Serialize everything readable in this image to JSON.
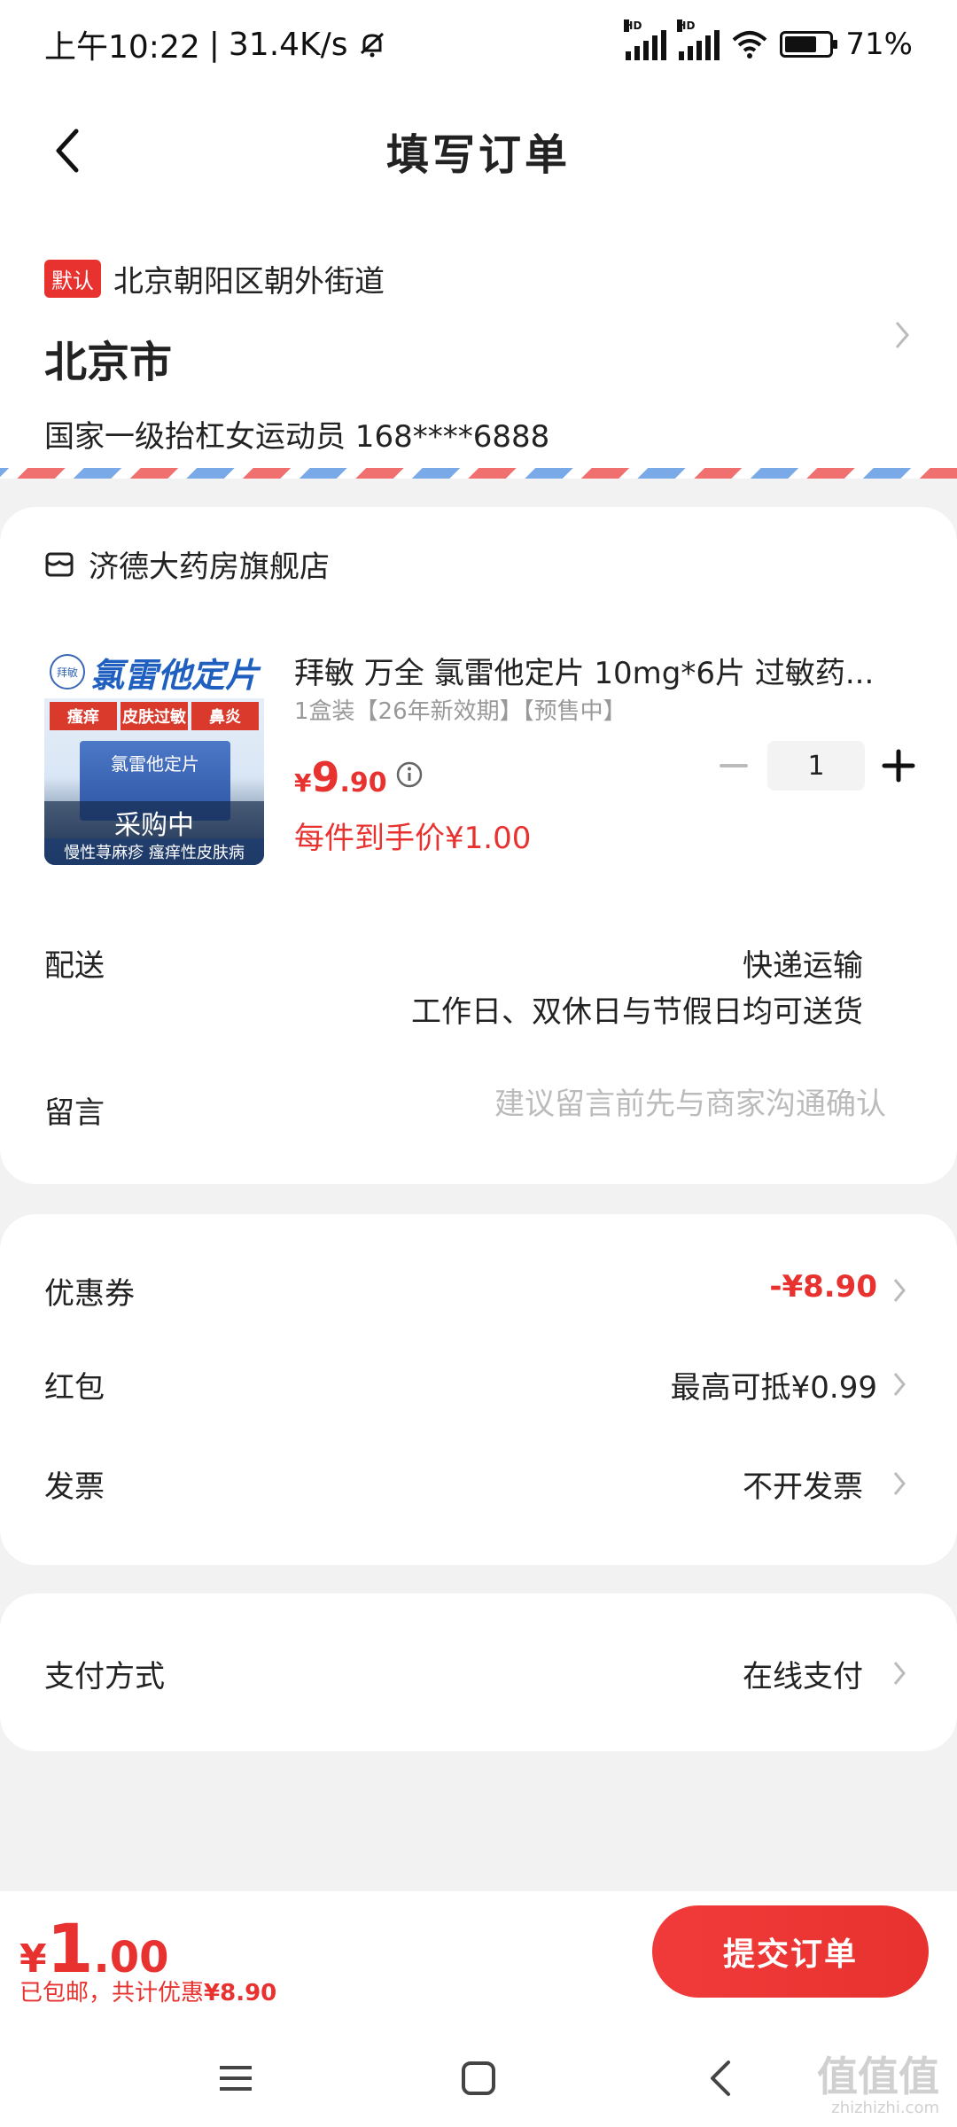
{
  "status_bar": {
    "time": "上午10:22",
    "speed": "31.4K/s",
    "battery": "71%",
    "battery_level": 0.71
  },
  "header": {
    "title": "填写订单"
  },
  "address": {
    "default_badge": "默认",
    "street": "北京朝阳区朝外街道",
    "city": "北京市",
    "contact": "国家一级抬杠女运动员  168****6888"
  },
  "store": {
    "name": "济德大药房旗舰店",
    "product": {
      "image_name": "氯雷他定片",
      "image_tags": [
        "瘙痒",
        "皮肤过敏",
        "鼻炎"
      ],
      "image_box": "氯雷他定片",
      "image_overlay": "采购中",
      "image_bottom": "慢性荨麻疹 瘙痒性皮肤病",
      "title": "拜敏 万全 氯雷他定片 10mg*6片 过敏药...",
      "spec": "1盒装【26年新效期】【预售中】",
      "price_currency": "¥",
      "price_int": "9",
      "price_dec": ".90",
      "final_price": "每件到手价¥1.00",
      "quantity": "1"
    },
    "delivery": {
      "label": "配送",
      "method": "快递运输",
      "note": "工作日、双休日与节假日均可送货"
    },
    "note": {
      "label": "留言",
      "placeholder": "建议留言前先与商家沟通确认"
    }
  },
  "discounts": {
    "coupon": {
      "label": "优惠券",
      "value": "-¥8.90"
    },
    "red_packet": {
      "label": "红包",
      "value": "最高可抵¥0.99"
    },
    "invoice": {
      "label": "发票",
      "value": "不开发票"
    }
  },
  "payment": {
    "label": "支付方式",
    "value": "在线支付"
  },
  "bottom": {
    "total_currency": "¥",
    "total_int": "1",
    "total_dec": ".00",
    "shipping_note": "已包邮，共计优惠",
    "saved": "¥8.90",
    "submit": "提交订单"
  },
  "watermark": {
    "text": "值值值",
    "url": "zhizhizhi.com"
  },
  "colors": {
    "accent_red": "#e8322f",
    "airmail_red": "#f07070",
    "airmail_blue": "#7aa9e8"
  }
}
